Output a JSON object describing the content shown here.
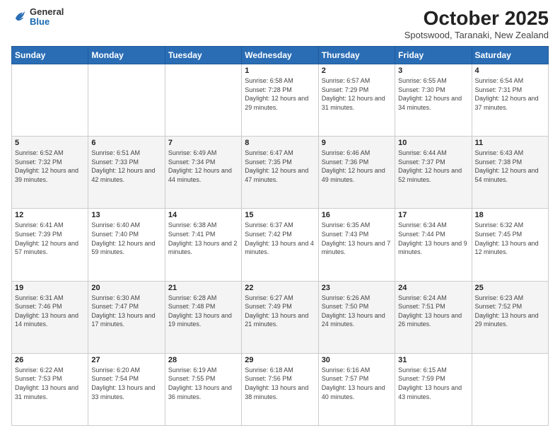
{
  "header": {
    "logo": {
      "general": "General",
      "blue": "Blue"
    },
    "title": "October 2025",
    "subtitle": "Spotswood, Taranaki, New Zealand"
  },
  "weekdays": [
    "Sunday",
    "Monday",
    "Tuesday",
    "Wednesday",
    "Thursday",
    "Friday",
    "Saturday"
  ],
  "weeks": [
    [
      {
        "day": null
      },
      {
        "day": null
      },
      {
        "day": null
      },
      {
        "day": "1",
        "sunrise": "6:58 AM",
        "sunset": "7:28 PM",
        "daylight": "12 hours and 29 minutes."
      },
      {
        "day": "2",
        "sunrise": "6:57 AM",
        "sunset": "7:29 PM",
        "daylight": "12 hours and 31 minutes."
      },
      {
        "day": "3",
        "sunrise": "6:55 AM",
        "sunset": "7:30 PM",
        "daylight": "12 hours and 34 minutes."
      },
      {
        "day": "4",
        "sunrise": "6:54 AM",
        "sunset": "7:31 PM",
        "daylight": "12 hours and 37 minutes."
      }
    ],
    [
      {
        "day": "5",
        "sunrise": "6:52 AM",
        "sunset": "7:32 PM",
        "daylight": "12 hours and 39 minutes."
      },
      {
        "day": "6",
        "sunrise": "6:51 AM",
        "sunset": "7:33 PM",
        "daylight": "12 hours and 42 minutes."
      },
      {
        "day": "7",
        "sunrise": "6:49 AM",
        "sunset": "7:34 PM",
        "daylight": "12 hours and 44 minutes."
      },
      {
        "day": "8",
        "sunrise": "6:47 AM",
        "sunset": "7:35 PM",
        "daylight": "12 hours and 47 minutes."
      },
      {
        "day": "9",
        "sunrise": "6:46 AM",
        "sunset": "7:36 PM",
        "daylight": "12 hours and 49 minutes."
      },
      {
        "day": "10",
        "sunrise": "6:44 AM",
        "sunset": "7:37 PM",
        "daylight": "12 hours and 52 minutes."
      },
      {
        "day": "11",
        "sunrise": "6:43 AM",
        "sunset": "7:38 PM",
        "daylight": "12 hours and 54 minutes."
      }
    ],
    [
      {
        "day": "12",
        "sunrise": "6:41 AM",
        "sunset": "7:39 PM",
        "daylight": "12 hours and 57 minutes."
      },
      {
        "day": "13",
        "sunrise": "6:40 AM",
        "sunset": "7:40 PM",
        "daylight": "12 hours and 59 minutes."
      },
      {
        "day": "14",
        "sunrise": "6:38 AM",
        "sunset": "7:41 PM",
        "daylight": "13 hours and 2 minutes."
      },
      {
        "day": "15",
        "sunrise": "6:37 AM",
        "sunset": "7:42 PM",
        "daylight": "13 hours and 4 minutes."
      },
      {
        "day": "16",
        "sunrise": "6:35 AM",
        "sunset": "7:43 PM",
        "daylight": "13 hours and 7 minutes."
      },
      {
        "day": "17",
        "sunrise": "6:34 AM",
        "sunset": "7:44 PM",
        "daylight": "13 hours and 9 minutes."
      },
      {
        "day": "18",
        "sunrise": "6:32 AM",
        "sunset": "7:45 PM",
        "daylight": "13 hours and 12 minutes."
      }
    ],
    [
      {
        "day": "19",
        "sunrise": "6:31 AM",
        "sunset": "7:46 PM",
        "daylight": "13 hours and 14 minutes."
      },
      {
        "day": "20",
        "sunrise": "6:30 AM",
        "sunset": "7:47 PM",
        "daylight": "13 hours and 17 minutes."
      },
      {
        "day": "21",
        "sunrise": "6:28 AM",
        "sunset": "7:48 PM",
        "daylight": "13 hours and 19 minutes."
      },
      {
        "day": "22",
        "sunrise": "6:27 AM",
        "sunset": "7:49 PM",
        "daylight": "13 hours and 21 minutes."
      },
      {
        "day": "23",
        "sunrise": "6:26 AM",
        "sunset": "7:50 PM",
        "daylight": "13 hours and 24 minutes."
      },
      {
        "day": "24",
        "sunrise": "6:24 AM",
        "sunset": "7:51 PM",
        "daylight": "13 hours and 26 minutes."
      },
      {
        "day": "25",
        "sunrise": "6:23 AM",
        "sunset": "7:52 PM",
        "daylight": "13 hours and 29 minutes."
      }
    ],
    [
      {
        "day": "26",
        "sunrise": "6:22 AM",
        "sunset": "7:53 PM",
        "daylight": "13 hours and 31 minutes."
      },
      {
        "day": "27",
        "sunrise": "6:20 AM",
        "sunset": "7:54 PM",
        "daylight": "13 hours and 33 minutes."
      },
      {
        "day": "28",
        "sunrise": "6:19 AM",
        "sunset": "7:55 PM",
        "daylight": "13 hours and 36 minutes."
      },
      {
        "day": "29",
        "sunrise": "6:18 AM",
        "sunset": "7:56 PM",
        "daylight": "13 hours and 38 minutes."
      },
      {
        "day": "30",
        "sunrise": "6:16 AM",
        "sunset": "7:57 PM",
        "daylight": "13 hours and 40 minutes."
      },
      {
        "day": "31",
        "sunrise": "6:15 AM",
        "sunset": "7:59 PM",
        "daylight": "13 hours and 43 minutes."
      },
      {
        "day": null
      }
    ]
  ]
}
